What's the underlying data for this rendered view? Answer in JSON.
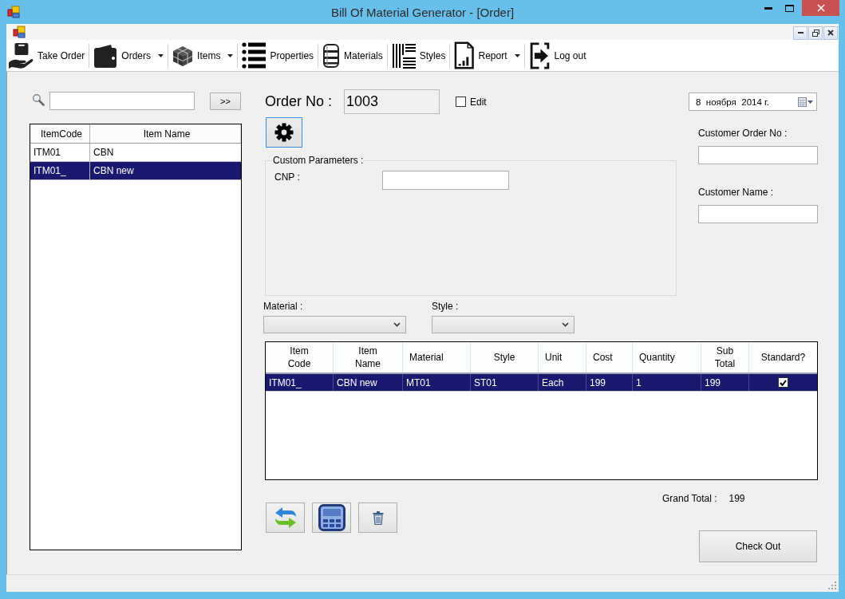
{
  "window": {
    "title": "Bill Of Material Generator - [Order]"
  },
  "toolbar": [
    {
      "label": "Take Order",
      "dropdown": false
    },
    {
      "label": "Orders",
      "dropdown": true
    },
    {
      "label": "Items",
      "dropdown": true
    },
    {
      "label": "Properties",
      "dropdown": false
    },
    {
      "label": "Materials",
      "dropdown": false
    },
    {
      "label": "Styles",
      "dropdown": false
    },
    {
      "label": "Report",
      "dropdown": true
    },
    {
      "label": "Log out",
      "dropdown": false
    }
  ],
  "item_search": {
    "button": ">>"
  },
  "item_list": {
    "columns": [
      "ItemCode",
      "Item Name"
    ],
    "rows": [
      {
        "cells": [
          "ITM01",
          "CBN"
        ],
        "selected": false
      },
      {
        "cells": [
          "ITM01_",
          "CBN new"
        ],
        "selected": true
      }
    ]
  },
  "order_no": {
    "label": "Order No :",
    "value": "1003"
  },
  "edit_checkbox": {
    "label": "Edit",
    "checked": false
  },
  "date_picker": {
    "value": "8  ноября  2014 г."
  },
  "custom_parameters": {
    "title": "Custom Parameters :",
    "fields": [
      {
        "label": "CNP :"
      }
    ]
  },
  "material": {
    "label": "Material :"
  },
  "style": {
    "label": "Style :"
  },
  "customer_order_no": {
    "label": "Customer Order No :"
  },
  "customer_name": {
    "label": "Customer Name :"
  },
  "order_table": {
    "columns": [
      "Item Code",
      "Item Name",
      "Material",
      "Style",
      "Unit",
      "Cost",
      "Quantity",
      "Sub Total",
      "Standard?"
    ],
    "rows": [
      {
        "cells": [
          "ITM01_",
          "CBN new",
          "MT01",
          "ST01",
          "Each",
          "199",
          "1",
          "199"
        ],
        "standard": true,
        "selected": true
      }
    ]
  },
  "grand_total": {
    "label": "Grand Total :",
    "value": "199"
  },
  "checkout_button": {
    "label": "Check Out"
  }
}
